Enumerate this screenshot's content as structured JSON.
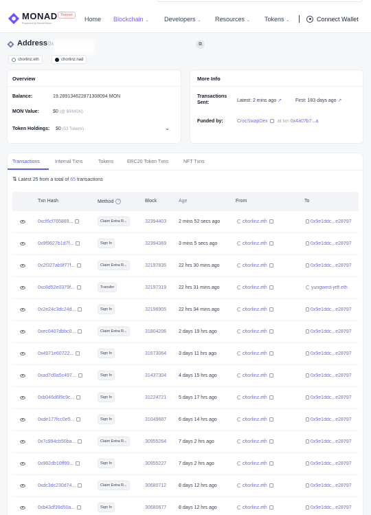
{
  "header": {
    "logo_text": "MONAD",
    "badge": "Testnet",
    "powered_by": "Powered by BlockVision",
    "nav": [
      {
        "label": "Home",
        "has_dropdown": false
      },
      {
        "label": "Blockchain",
        "has_dropdown": true,
        "active": true
      },
      {
        "label": "Developers",
        "has_dropdown": true
      },
      {
        "label": "Resources",
        "has_dropdown": true
      },
      {
        "label": "Tokens",
        "has_dropdown": true
      }
    ],
    "connect_wallet": "Connect Wallet"
  },
  "address": {
    "title": "Address",
    "short": "0x",
    "tags": [
      "chorlinz.eth",
      "chorlinz.nad"
    ]
  },
  "overview": {
    "title": "Overview",
    "balance_label": "Balance:",
    "balance_value": "19.289134622871308094 MON",
    "mon_value_label": "MON Value:",
    "mon_value": "$0",
    "mon_value_sub": "(@ $0/MON)",
    "token_holdings_label": "Token Holdings:",
    "token_holdings": "$0",
    "token_holdings_sub": "(53 Tokens)"
  },
  "more_info": {
    "title": "More Info",
    "tx_sent_label_1": "Transactions",
    "tx_sent_label_2": "Sent:",
    "latest_label": "Latest:",
    "latest_value": "2 mins ago",
    "first_label": "First:",
    "first_value": "183 days ago",
    "funded_by_label": "Funded by:",
    "funded_by": "CrocSwapDex",
    "at_txn": "at txn",
    "funded_txn": "0x4a07b7...a"
  },
  "tabs": [
    "Transactions",
    "Internal Txns",
    "Tokens",
    "ERC20 Token Txns",
    "NFT Txns"
  ],
  "summary": {
    "prefix": "Latest 25 from a total of",
    "count": "65",
    "suffix": "transactions"
  },
  "table": {
    "columns": [
      "Txn Hash",
      "Method",
      "Block",
      "Age",
      "From",
      "To"
    ],
    "rows": [
      {
        "hash": "0xcf6cf765889...",
        "method": "Claim Extra R...",
        "block": "32394403",
        "age": "2 mins 52 secs ago",
        "from": "chorlinz.eth",
        "to": "0x9e1ddc...e28797"
      },
      {
        "hash": "0x9f9627b1d7f...",
        "method": "Sign In",
        "block": "32394369",
        "age": "3 mins 5 secs ago",
        "from": "chorlinz.eth",
        "to": "0x9e1ddc...e28797"
      },
      {
        "hash": "0x2f327ab9f77f...",
        "method": "Claim Extra R...",
        "block": "32197835",
        "age": "22 hrs 30 mins ago",
        "from": "chorlinz.eth",
        "to": "0x9e1ddc...e28797"
      },
      {
        "hash": "0xc8d52e0379f...",
        "method": "Transfer",
        "block": "32197319",
        "age": "22 hrs 31 mins ago",
        "from": "chorlinz.eth",
        "to": "yungwest-jeff.eth"
      },
      {
        "hash": "0x2e24c3dc24d...",
        "method": "Sign In",
        "block": "32196905",
        "age": "22 hrs 34 mins ago",
        "from": "chorlinz.eth",
        "to": "0x9e1ddc...e28797"
      },
      {
        "hash": "0xec0407dbbc0...",
        "method": "Claim Extra R...",
        "block": "31804206",
        "age": "2 days 19 hrs ago",
        "from": "chorlinz.eth",
        "to": "0x9e1ddc...e28797"
      },
      {
        "hash": "0x4971e60722...",
        "method": "Sign In",
        "block": "31673064",
        "age": "3 days 11 hrs ago",
        "from": "chorlinz.eth",
        "to": "0x9e1ddc...e28797"
      },
      {
        "hash": "0xad7d9a5c497...",
        "method": "Sign In",
        "block": "31437304",
        "age": "4 days 15 hrs ago",
        "from": "chorlinz.eth",
        "to": "0x9e1ddc...e28797"
      },
      {
        "hash": "0xb046d6f9c9c...",
        "method": "Sign In",
        "block": "31224721",
        "age": "5 days 17 hrs ago",
        "from": "chorlinz.eth",
        "to": "0x9e1ddc...e28797"
      },
      {
        "hash": "0xde177fcc0e5...",
        "method": "Sign In",
        "block": "31049687",
        "age": "6 days 14 hrs ago",
        "from": "chorlinz.eth",
        "to": "0x9e1ddc...e28797"
      },
      {
        "hash": "0x7c994cb50ba...",
        "method": "Claim Extra R...",
        "block": "30955264",
        "age": "7 days 2 hrs ago",
        "from": "chorlinz.eth",
        "to": "0x9e1ddc...e28797"
      },
      {
        "hash": "0x982db10ff99...",
        "method": "Sign In",
        "block": "30955227",
        "age": "7 days 2 hrs ago",
        "from": "chorlinz.eth",
        "to": "0x9e1ddc...e28797"
      },
      {
        "hash": "0xdc3dc230d74...",
        "method": "Claim Extra R...",
        "block": "30680712",
        "age": "8 days 12 hrs ago",
        "from": "chorlinz.eth",
        "to": "0x9e1ddc...e28797"
      },
      {
        "hash": "0xb43df39d50a...",
        "method": "Sign In",
        "block": "30680677",
        "age": "8 days 12 hrs ago",
        "from": "chorlinz.eth",
        "to": "0x9e1ddc...e28797"
      }
    ]
  },
  "colors": {
    "accent": "#7b61ff",
    "link": "#6d6fd8",
    "badge": "#e05a5a"
  }
}
